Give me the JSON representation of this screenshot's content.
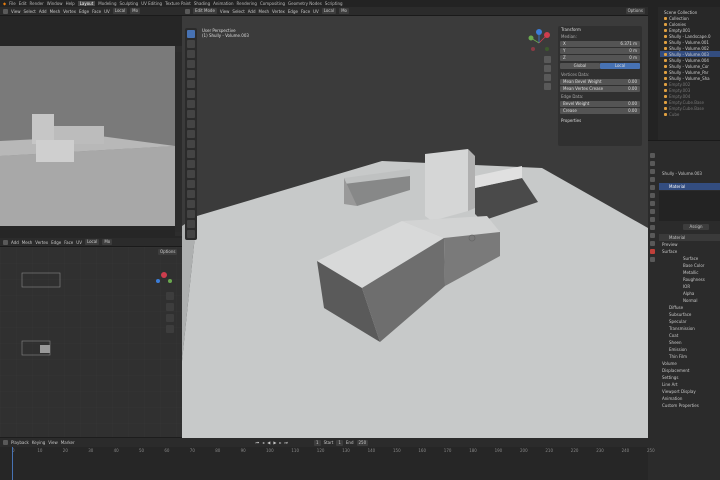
{
  "topbar": {
    "menus": [
      "File",
      "Edit",
      "Render",
      "Window",
      "Help"
    ],
    "workspaces": [
      "Layout",
      "Modeling",
      "Sculpting",
      "UV Editing",
      "Texture Paint",
      "Shading",
      "Animation",
      "Rendering",
      "Compositing",
      "Geometry Nodes",
      "Scripting"
    ],
    "active_workspace": "Layout"
  },
  "left_top_header": {
    "items": [
      "Edit Mode",
      "View",
      "Select",
      "Add",
      "Mesh",
      "Vertex",
      "Edge",
      "Face",
      "UV"
    ],
    "transform": "Local",
    "mirror": "Mo"
  },
  "left_bottom_header": {
    "items": [
      "Add",
      "Mesh",
      "Vertex",
      "Edge",
      "Face",
      "UV"
    ],
    "transform": "Local",
    "mirror": "Mo",
    "options": "Options"
  },
  "main_header": {
    "mode": "Edit Mode",
    "items": [
      "View",
      "Select",
      "Add",
      "Mesh",
      "Vertex",
      "Edge",
      "Face",
      "UV"
    ],
    "transform": "Local",
    "mirror": "Mo",
    "options": "Options"
  },
  "viewport": {
    "title": "User Perspective",
    "object": "(1) Shully - Volume.003"
  },
  "npanel": {
    "section": "Transform",
    "sub": "Median:",
    "rows": [
      {
        "label": "X",
        "value": "6.371 m"
      },
      {
        "label": "Y",
        "value": "0 m"
      },
      {
        "label": "Z",
        "value": "0 m"
      }
    ],
    "global": "Global",
    "local": "Local",
    "vertex_data": "Vertices Data:",
    "bevel_weight": "Mean Bevel Weight",
    "bevel_weight_val": "0.00",
    "crease": "Mean Vertex Crease",
    "crease_val": "0.00",
    "edge_data": "Edge Data:",
    "edge_bevel": "Bevel Weight",
    "edge_bevel_val": "0.00",
    "edge_crease": "Crease",
    "edge_crease_val": "0.00",
    "properties": "Properties"
  },
  "outliner": {
    "title": "Scene Collection",
    "rows": [
      {
        "label": "Collection",
        "cls": ""
      },
      {
        "label": "Colonies",
        "cls": ""
      },
      {
        "label": "Empty.001",
        "cls": ""
      },
      {
        "label": "Shully - Landscape.0",
        "cls": ""
      },
      {
        "label": "Shully - Volume.001",
        "cls": ""
      },
      {
        "label": "Shully - Volume.002",
        "cls": ""
      },
      {
        "label": "Shully - Volume.003",
        "cls": "sel"
      },
      {
        "label": "Shully - Volume.004",
        "cls": ""
      },
      {
        "label": "Shully - Volume_Cor",
        "cls": ""
      },
      {
        "label": "Shully - Volume_Par",
        "cls": ""
      },
      {
        "label": "Shully - Volume_Sha",
        "cls": ""
      },
      {
        "label": "Empty.002",
        "cls": "dim"
      },
      {
        "label": "Empty.003",
        "cls": "dim"
      },
      {
        "label": "Empty.004",
        "cls": "dim"
      },
      {
        "label": "Empty.Cube.Base",
        "cls": "dim"
      },
      {
        "label": "Empty.Cube.Base",
        "cls": "dim"
      },
      {
        "label": "Cube",
        "cls": "dim"
      }
    ]
  },
  "properties": {
    "object": "Shully - Volume.003",
    "slot": "Material",
    "assign": "Assign",
    "material": "Material",
    "sections": [
      "Preview",
      "Surface"
    ],
    "fields": [
      "Surface",
      "Base Color",
      "Metallic",
      "Roughness",
      "IOR",
      "Alpha",
      "Normal"
    ],
    "subsections": [
      "Diffuse",
      "Subsurface",
      "Specular",
      "Transmission",
      "Coat",
      "Sheen",
      "Emission",
      "Thin Film"
    ],
    "more": [
      "Volume",
      "Displacement",
      "Settings",
      "Line Art",
      "Viewport Display",
      "Animation",
      "Custom Properties"
    ],
    "displacement": "Displacement"
  },
  "timeline": {
    "playback": "Playback",
    "keying": "Keying",
    "view": "View",
    "marker": "Marker",
    "current_frame": "1",
    "start_label": "Start",
    "start": "1",
    "end_label": "End",
    "end": "250",
    "ticks": [
      "0",
      "10",
      "20",
      "30",
      "40",
      "50",
      "60",
      "70",
      "80",
      "90",
      "100",
      "110",
      "120",
      "130",
      "140",
      "150",
      "160",
      "170",
      "180",
      "190",
      "200",
      "210",
      "220",
      "230",
      "240",
      "250"
    ]
  },
  "colors": {
    "accent": "#4772b3",
    "bg": "#1d1d1d",
    "viewport_bg": "#3a3a3a"
  }
}
